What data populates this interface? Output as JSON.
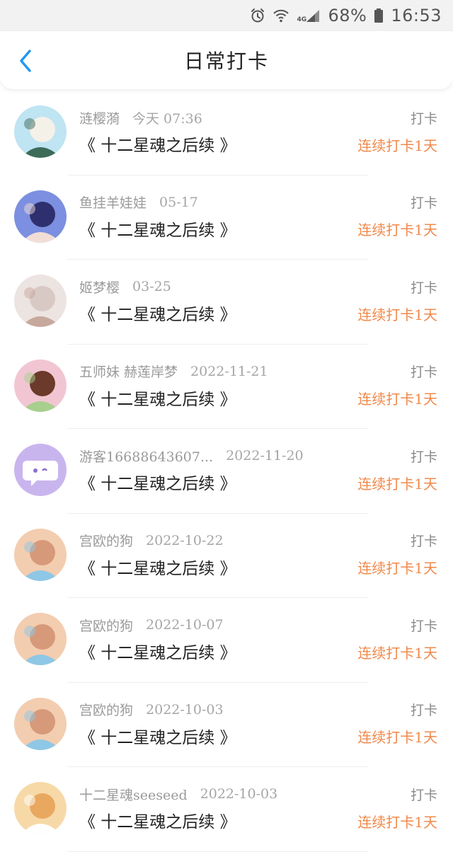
{
  "status_bar": {
    "battery": "68%",
    "time": "16:53",
    "network": "4G",
    "icons": [
      "alarm-icon",
      "wifi-icon",
      "signal-icon",
      "battery-icon"
    ]
  },
  "header": {
    "title": "日常打卡",
    "back_icon": "chevron-left-icon",
    "accent_color": "#2196f3"
  },
  "colors": {
    "streak": "#f0884a",
    "meta": "#9a9a9a"
  },
  "checkins": [
    {
      "user": "涟樱漪",
      "date": "今天 07:36",
      "work": "《 十二星魂之后续 》",
      "label": "打卡",
      "streak": "连续打卡1天",
      "avatar_palette": [
        "#bfe4f2",
        "#f4f1e8",
        "#3d6b5a"
      ]
    },
    {
      "user": "鱼挂羊娃娃",
      "date": "05-17",
      "work": "《 十二星魂之后续 》",
      "label": "打卡",
      "streak": "连续打卡1天",
      "avatar_palette": [
        "#7c8fe0",
        "#2e2f6e",
        "#f3ded6"
      ]
    },
    {
      "user": "姬梦樱",
      "date": "03-25",
      "work": "《 十二星魂之后续 》",
      "label": "打卡",
      "streak": "连续打卡1天",
      "avatar_palette": [
        "#ece4e1",
        "#d9c9c4",
        "#c7a89c"
      ]
    },
    {
      "user": "五师妹 赫莲岸梦",
      "date": "2022-11-21",
      "work": "《 十二星魂之后续 》",
      "label": "打卡",
      "streak": "连续打卡1天",
      "avatar_palette": [
        "#f1c6d2",
        "#6b3a2a",
        "#a8cf8e"
      ]
    },
    {
      "user": "游客16688643607...",
      "date": "2022-11-20",
      "work": "《 十二星魂之后续 》",
      "label": "打卡",
      "streak": "连续打卡1天",
      "avatar_palette": [
        "#c9b5ee",
        "#ffffff",
        "#8d6fd0"
      ]
    },
    {
      "user": "宫欧的狗",
      "date": "2022-10-22",
      "work": "《 十二星魂之后续 》",
      "label": "打卡",
      "streak": "连续打卡1天",
      "avatar_palette": [
        "#f3cdb0",
        "#d69a7a",
        "#8fc7e6"
      ]
    },
    {
      "user": "宫欧的狗",
      "date": "2022-10-07",
      "work": "《 十二星魂之后续 》",
      "label": "打卡",
      "streak": "连续打卡1天",
      "avatar_palette": [
        "#f3cdb0",
        "#d69a7a",
        "#8fc7e6"
      ]
    },
    {
      "user": "宫欧的狗",
      "date": "2022-10-03",
      "work": "《 十二星魂之后续 》",
      "label": "打卡",
      "streak": "连续打卡1天",
      "avatar_palette": [
        "#f3cdb0",
        "#d69a7a",
        "#8fc7e6"
      ]
    },
    {
      "user": "十二星魂seeseed",
      "date": "2022-10-03",
      "work": "《 十二星魂之后续 》",
      "label": "打卡",
      "streak": "连续打卡1天",
      "avatar_palette": [
        "#f7d9a8",
        "#e9a860",
        "#ffffff"
      ]
    }
  ]
}
